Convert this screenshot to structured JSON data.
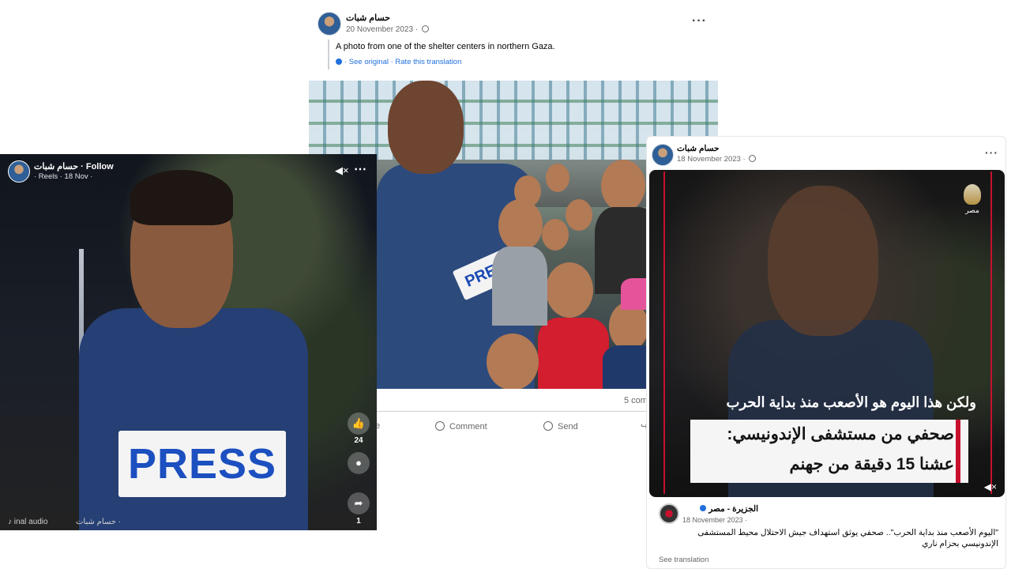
{
  "post_a": {
    "author": "حسام شبات",
    "date": "20 November 2023 ·",
    "more": "···",
    "translated_text": "A photo from one of the shelter centers in northern Gaza.",
    "translation_links": "· See original · Rate this translation",
    "photo_press_label": "PRESS",
    "comments_count": "5 com",
    "actions": {
      "like_partial": "e",
      "comment": "Comment",
      "send": "Send"
    }
  },
  "reel_b": {
    "author_follow": "حسام شبات · Follow",
    "sub": "· Reels · 18 Nov ·",
    "press_label": "PRESS",
    "like_count": "24",
    "share_count": "1",
    "audio": "inal audio",
    "owner": "حسام شبات ·"
  },
  "post_c": {
    "author": "حسام شبات",
    "date": "18 November 2023 ·",
    "more": "···",
    "video": {
      "logo_text": "مصر",
      "caption_top": "ولكن هذا اليوم هو الأصعب منذ بداية الحرب",
      "caption_line1": "صحفي من مستشفى الإندونيسي:",
      "caption_line2": "عشنا 15 دقيقة من جهنم"
    },
    "shared": {
      "page_name": "الجزيرة - مصر",
      "date": "18 November 2023 ·",
      "text": "\"اليوم الأصعب منذ بداية الحرب\".. صحفي يوثق استهداف جيش الاحتلال محيط المستشفى الإندونيسي بحزام ناري",
      "see_translation": "See translation"
    }
  },
  "colors": {
    "link_blue": "#216fdb",
    "aljazeera_red": "#c8102e",
    "vest_blue": "#263f74"
  }
}
